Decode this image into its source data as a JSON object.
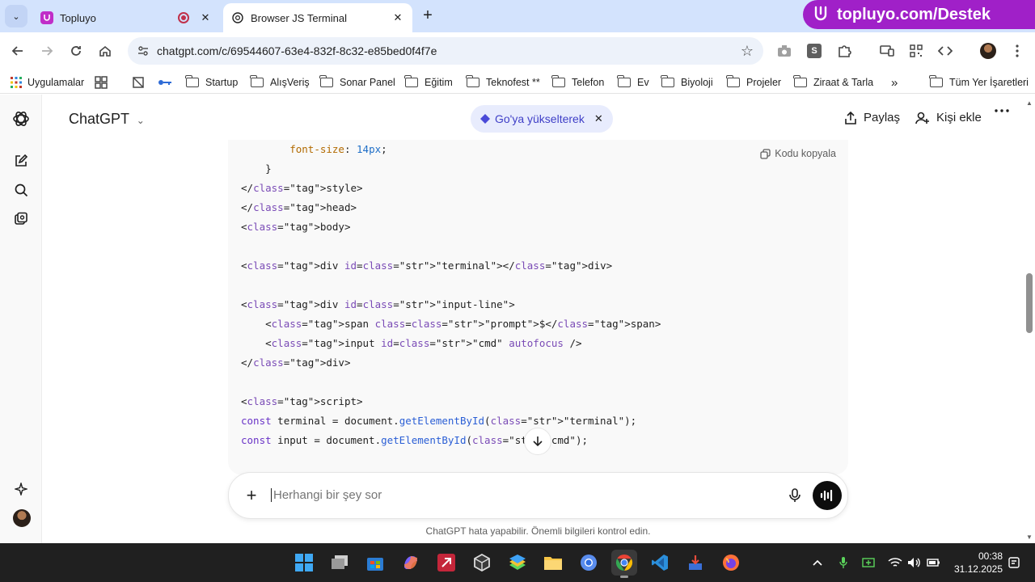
{
  "browser": {
    "tabs": [
      {
        "title": "Topluyo",
        "active": false
      },
      {
        "title": "Browser JS Terminal",
        "active": true
      }
    ],
    "banner_text": "topluyo.com/Destek",
    "url": "chatgpt.com/c/69544607-63e4-832f-8c32-e85bed0f4f7e",
    "bookmarks": [
      {
        "label": "Uygulamalar",
        "kind": "apps"
      },
      {
        "label": "Startup",
        "kind": "folder"
      },
      {
        "label": "AlışVeriş",
        "kind": "folder"
      },
      {
        "label": "Sonar Panel",
        "kind": "folder"
      },
      {
        "label": "Eğitim",
        "kind": "folder"
      },
      {
        "label": "Teknofest **",
        "kind": "folder"
      },
      {
        "label": "Telefon",
        "kind": "folder"
      },
      {
        "label": "Ev",
        "kind": "folder"
      },
      {
        "label": "Biyoloji",
        "kind": "folder"
      },
      {
        "label": "Projeler",
        "kind": "folder"
      },
      {
        "label": "Ziraat & Tarla",
        "kind": "folder"
      },
      {
        "label": "Tüm Yer İşaretleri",
        "kind": "folder"
      }
    ]
  },
  "chat": {
    "model_label": "ChatGPT",
    "upgrade_label": "Go'ya yükselterek",
    "share_label": "Paylaş",
    "add_person_label": "Kişi ekle",
    "copy_code_label": "Kodu kopyala",
    "code_lines": [
      "        font-size: 14px;",
      "    }",
      "</style>",
      "</head>",
      "<body>",
      "",
      "<div id=\"terminal\"></div>",
      "",
      "<div id=\"input-line\">",
      "    <span class=\"prompt\">$</span>",
      "    <input id=\"cmd\" autofocus />",
      "</div>",
      "",
      "<script>",
      "const terminal = document.getElementById(\"terminal\");",
      "const input = document.getElementById(\"cmd\");"
    ],
    "composer_placeholder": "Herhangi bir şey sor",
    "disclaimer": "ChatGPT hata yapabilir. Önemli bilgileri kontrol edin."
  },
  "taskbar": {
    "time": "00:38",
    "date": "31.12.2025"
  },
  "colors": {
    "tabstrip": "#d3e3fd",
    "banner": "#a020c8",
    "upgrade_bg": "#e8ecfd",
    "upgrade_text": "#3f3fc7",
    "taskbar": "#202020"
  }
}
